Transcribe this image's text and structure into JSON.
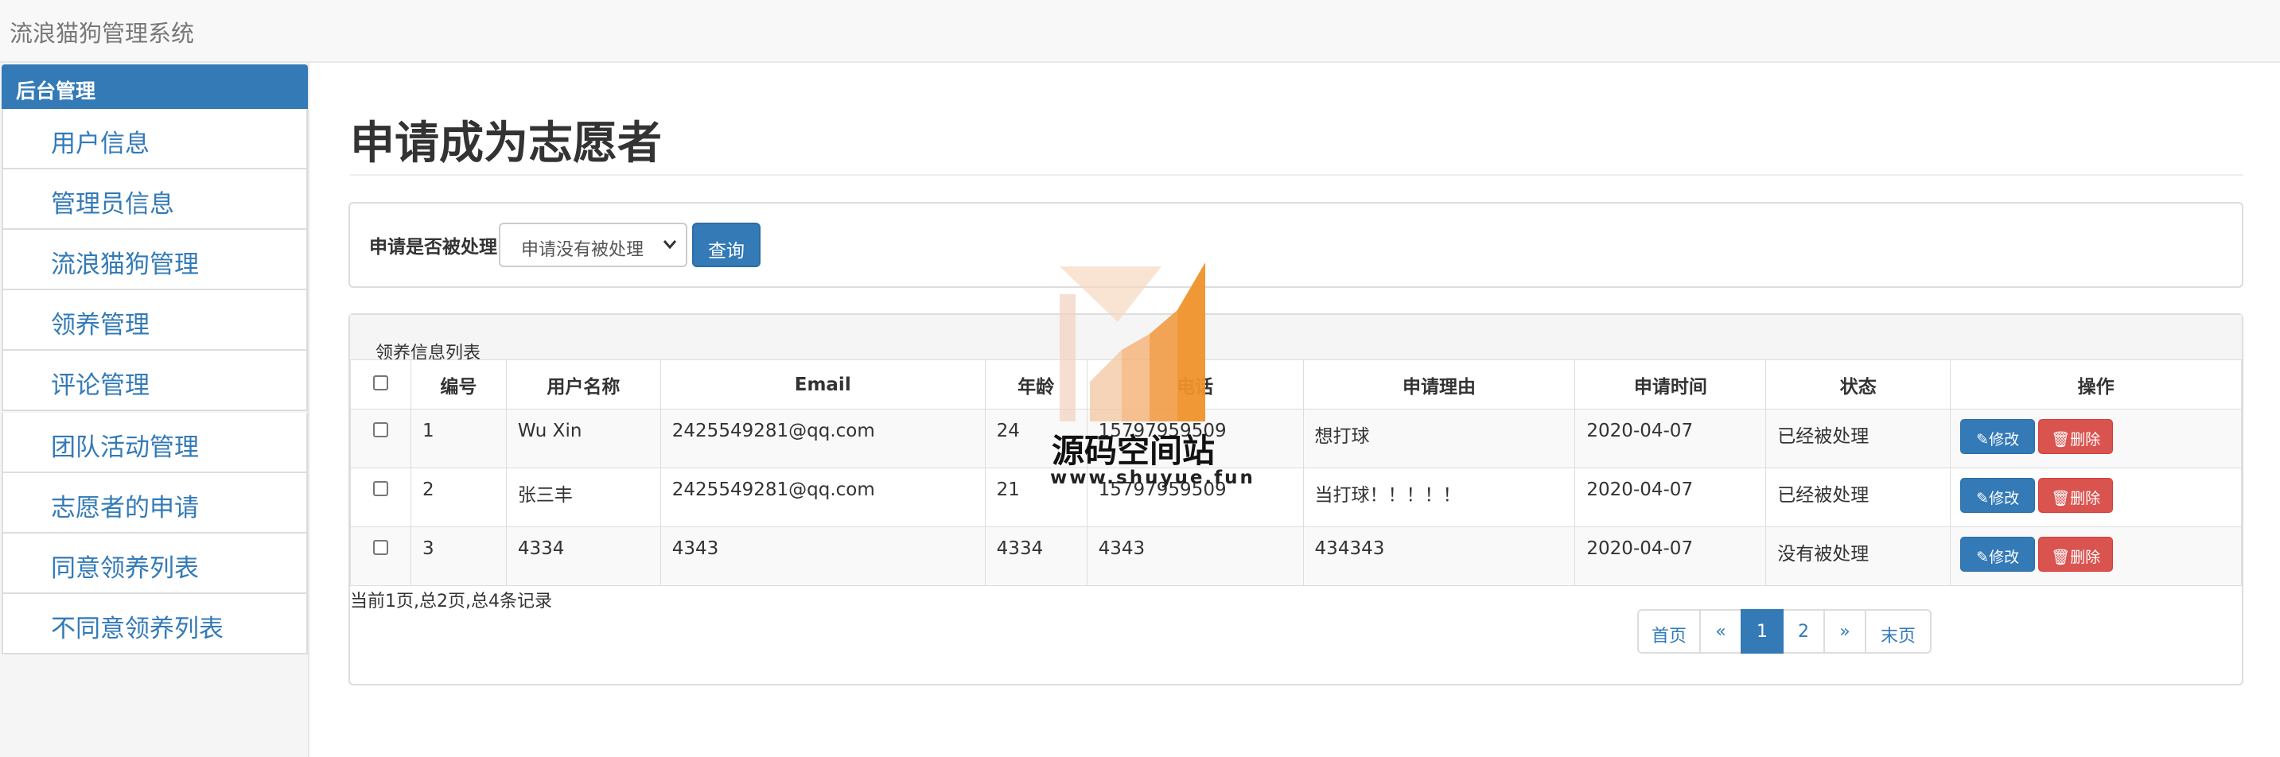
{
  "app": {
    "title": "流浪猫狗管理系统"
  },
  "sidebar": {
    "header": "后台管理",
    "items": [
      {
        "label": "用户信息"
      },
      {
        "label": "管理员信息"
      },
      {
        "label": "流浪猫狗管理"
      },
      {
        "label": "领养管理"
      },
      {
        "label": "评论管理"
      },
      {
        "label": "团队活动管理"
      },
      {
        "label": "志愿者的申请"
      },
      {
        "label": "同意领养列表"
      },
      {
        "label": "不同意领养列表"
      }
    ]
  },
  "main": {
    "title": "申请成为志愿者",
    "filter": {
      "label": "申请是否被处理",
      "selected": "申请没有被处理",
      "query_label": "查询"
    },
    "list": {
      "caption": "领养信息列表",
      "columns": [
        "编号",
        "用户名称",
        "Email",
        "年龄",
        "电话",
        "申请理由",
        "申请时间",
        "状态",
        "操作"
      ],
      "rows": [
        {
          "id": "1",
          "name": "Wu Xin",
          "email": "2425549281@qq.com",
          "age": "24",
          "phone": "15797959509",
          "reason": "想打球",
          "time": "2020-04-07",
          "status": "已经被处理"
        },
        {
          "id": "2",
          "name": "张三丰",
          "email": "2425549281@qq.com",
          "age": "21",
          "phone": "15797959509",
          "reason": "当打球！！！！！",
          "time": "2020-04-07",
          "status": "已经被处理"
        },
        {
          "id": "3",
          "name": "4334",
          "email": "4343",
          "age": "4334",
          "phone": "4343",
          "reason": "434343",
          "time": "2020-04-07",
          "status": "没有被处理"
        }
      ],
      "edit_label": "修改",
      "delete_label": "删除"
    },
    "summary": "当前1页,总2页,总4条记录",
    "pager": {
      "first": "首页",
      "prev": "«",
      "pages": [
        "1",
        "2"
      ],
      "current": "1",
      "next": "»",
      "last": "末页"
    }
  },
  "watermark": {
    "name": "源码空间站",
    "url": "www.shuyue.fun"
  },
  "colors": {
    "primary": "#337ab7",
    "danger": "#d9534f",
    "watermark_orange": "#f0922b"
  },
  "icons": {
    "edit": "pencil-icon",
    "delete": "trash-icon",
    "select": "chevron-down-icon"
  }
}
